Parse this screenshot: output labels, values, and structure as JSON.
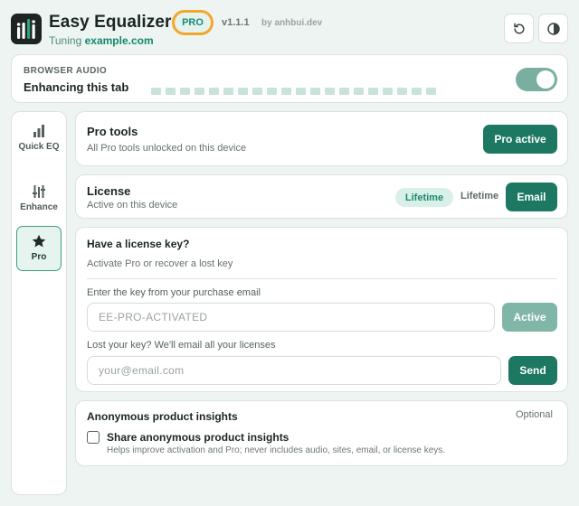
{
  "header": {
    "title": "Easy Equalizer",
    "badge": "PRO",
    "version": "v1.1.1",
    "byline": "by anhbui.dev",
    "tuning_prefix": "Tuning",
    "tuning_domain": "example.com",
    "reset_icon": "reset-icon",
    "theme_icon": "theme-contrast-icon"
  },
  "audio": {
    "label": "BROWSER AUDIO",
    "status": "Enhancing this tab",
    "toggle_on": true,
    "meter_segments": 20
  },
  "sidebar": {
    "items": [
      {
        "label": "Quick EQ",
        "icon": "bars-icon",
        "active": false
      },
      {
        "label": "Enhance",
        "icon": "sliders-icon",
        "active": false
      },
      {
        "label": "Pro",
        "icon": "star-icon",
        "active": true
      }
    ]
  },
  "pro_tools": {
    "title": "Pro tools",
    "subtitle": "All Pro tools unlocked on this device",
    "button": "Pro active"
  },
  "license": {
    "title": "License",
    "subtitle": "Active on this device",
    "chip": "Lifetime",
    "plan": "Lifetime",
    "button": "Email"
  },
  "license_key": {
    "title": "Have a license key?",
    "subtitle": "Activate Pro or recover a lost key",
    "key_label": "Enter the key from your purchase email",
    "key_placeholder": "EE-PRO-ACTIVATED",
    "key_button": "Active",
    "email_label": "Lost your key? We'll email all your licenses",
    "email_placeholder": "your@email.com",
    "email_button": "Send"
  },
  "insights": {
    "title": "Anonymous product insights",
    "optional": "Optional",
    "checkbox_label": "Share anonymous product insights",
    "checkbox_checked": false,
    "help": "Helps improve activation and Pro; never includes audio, sites, email, or license keys."
  },
  "colors": {
    "accent": "#1c7861",
    "badge_ring": "#f4a62a",
    "background": "#edf4f1"
  }
}
